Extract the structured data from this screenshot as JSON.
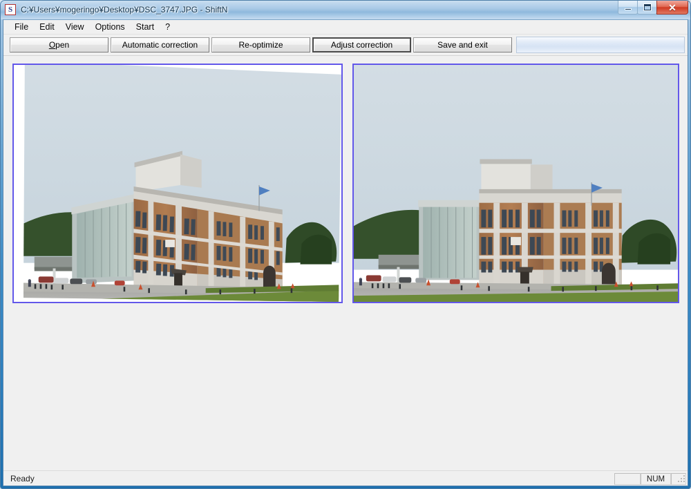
{
  "window": {
    "title": "C:¥Users¥mogeringo¥Desktop¥DSC_3747.JPG - ShiftN",
    "app_name": "ShiftN",
    "icon_letter": "S",
    "controls": {
      "minimize_label": "Minimize",
      "maximize_label": "Maximize",
      "close_label": "Close",
      "close_glyph": "✕"
    }
  },
  "menubar": {
    "items": [
      {
        "label": "File"
      },
      {
        "label": "Edit"
      },
      {
        "label": "View"
      },
      {
        "label": "Options"
      },
      {
        "label": "Start"
      },
      {
        "label": "?"
      }
    ]
  },
  "toolbar": {
    "buttons": [
      {
        "label": "Open",
        "accel": "O",
        "default": false
      },
      {
        "label": "Automatic correction",
        "accel": "",
        "default": false
      },
      {
        "label": "Re-optimize",
        "accel": "",
        "default": false
      },
      {
        "label": "Adjust correction",
        "accel": "",
        "default": true
      },
      {
        "label": "Save and exit",
        "accel": "",
        "default": false
      }
    ]
  },
  "panels": {
    "left": {
      "name": "original-image",
      "border_color": "#6257ea",
      "caption": ""
    },
    "right": {
      "name": "corrected-image",
      "border_color": "#6257ea",
      "caption": ""
    }
  },
  "statusbar": {
    "message": "Ready",
    "panes": [
      {
        "label": ""
      },
      {
        "label": "NUM"
      },
      {
        "label": ""
      }
    ]
  },
  "colors": {
    "accent": "#6257ea",
    "client_bg": "#f0f0f0",
    "frame_blue": "#2f81bf",
    "close_red": "#cf3a23"
  }
}
